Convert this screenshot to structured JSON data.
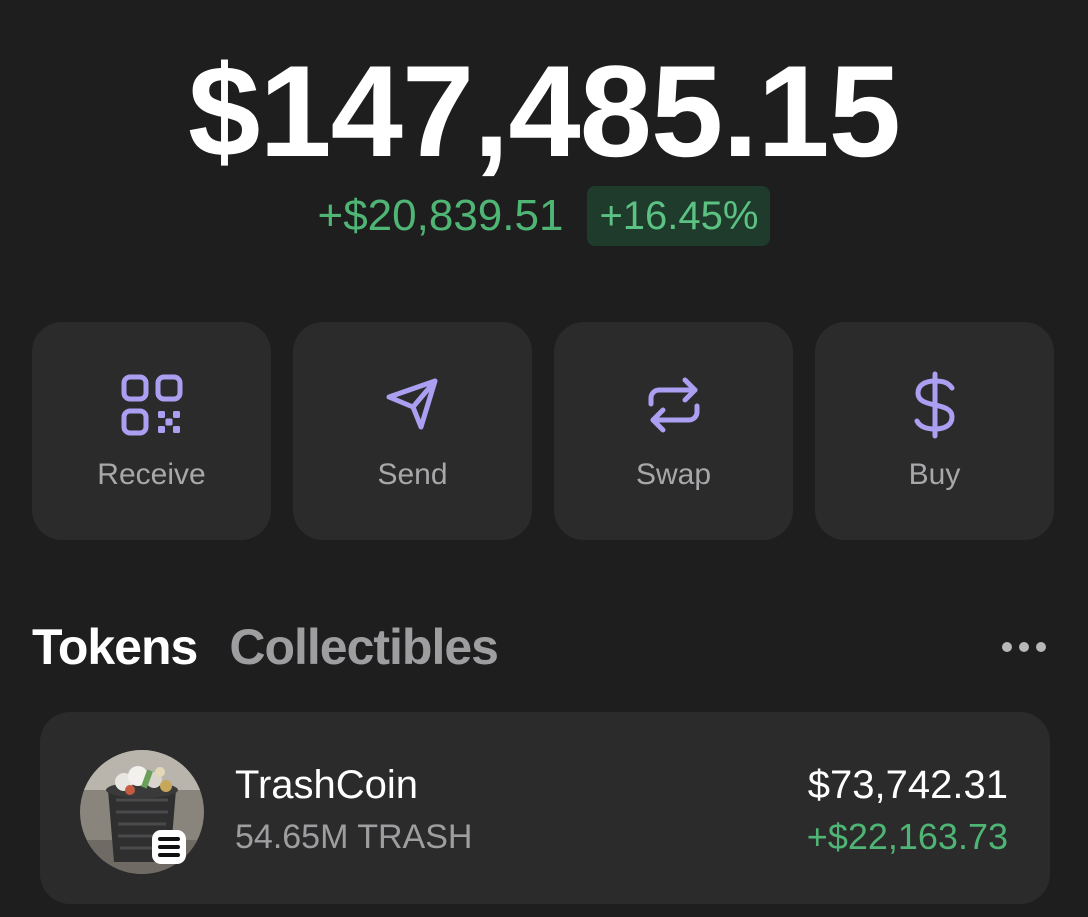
{
  "wallet": {
    "balance": "$147,485.15",
    "change_amount": "+$20,839.51",
    "change_percent": "+16.45%"
  },
  "actions": [
    {
      "label": "Receive",
      "icon": "qr-code-icon"
    },
    {
      "label": "Send",
      "icon": "send-arrow-icon"
    },
    {
      "label": "Swap",
      "icon": "swap-arrows-icon"
    },
    {
      "label": "Buy",
      "icon": "dollar-sign-icon"
    }
  ],
  "tabs": [
    {
      "label": "Tokens",
      "active": true
    },
    {
      "label": "Collectibles",
      "active": false
    }
  ],
  "tokens": [
    {
      "name": "TrashCoin",
      "amount": "54.65M TRASH",
      "value": "$73,742.31",
      "change": "+$22,163.73",
      "icon": "trash-can-avatar",
      "chain_badge": "solana-icon"
    }
  ],
  "colors": {
    "background": "#1e1e1f",
    "card": "#2b2b2c",
    "accent": "#ab9ff2",
    "positive": "#4fb574",
    "positive_badge_bg": "#1f3b2b"
  }
}
